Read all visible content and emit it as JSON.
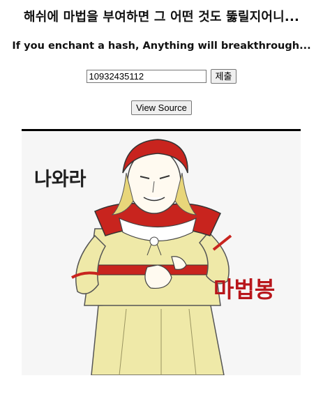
{
  "header": {
    "title": "해쉬에 마법을 부여하면 그 어떤 것도 뚫릴지어니...",
    "subtitle": "If you enchant a hash, Anything will breakthrough..."
  },
  "form": {
    "input_value": "10932435112",
    "submit_label": "제출"
  },
  "view_source_label": "View Source",
  "image": {
    "caption_left": "나와라",
    "caption_right": "마법봉"
  }
}
